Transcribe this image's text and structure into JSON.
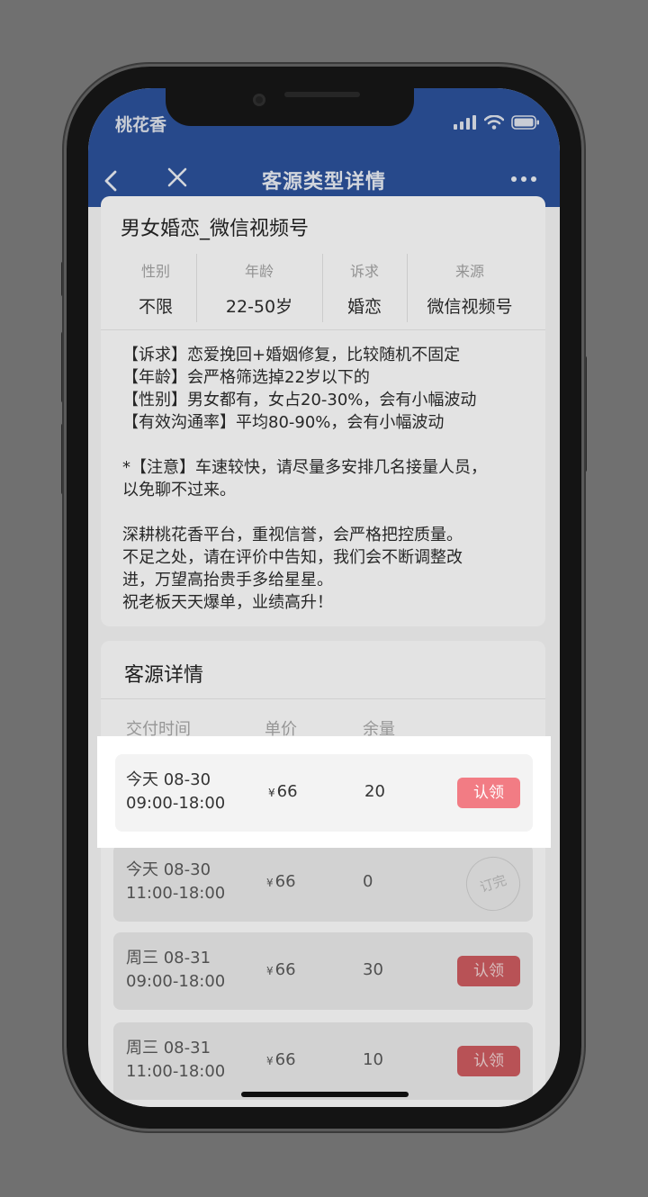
{
  "status_bar": {
    "carrier": "桃花香"
  },
  "nav": {
    "title": "客源类型详情"
  },
  "summary": {
    "title": "男女婚恋_微信视频号",
    "attributes": [
      {
        "label": "性别",
        "value": "不限"
      },
      {
        "label": "年龄",
        "value": "22-50岁"
      },
      {
        "label": "诉求",
        "value": "婚恋"
      },
      {
        "label": "来源",
        "value": "微信视频号"
      }
    ],
    "description": [
      "【诉求】恋爱挽回+婚姻修复，比较随机不固定",
      "【年龄】会严格筛选掉22岁以下的",
      "【性别】男女都有，女占20-30%，会有小幅波动",
      "【有效沟通率】平均80-90%，会有小幅波动",
      "",
      "*【注意】车速较快，请尽量多安排几名接量人员，",
      "以免聊不过来。",
      "",
      "深耕桃花香平台，重视信誉，会严格把控质量。",
      "不足之处，请在评价中告知，我们会不断调整改",
      "进，万望高抬贵手多给星星。",
      "祝老板天天爆单，业绩高升！"
    ]
  },
  "details": {
    "title": "客源详情",
    "columns": [
      "交付时间",
      "单价",
      "余量"
    ],
    "currency": "¥",
    "claim_label": "认领",
    "soldout_label": "订完",
    "rows": [
      {
        "day": "今天 08-30",
        "time": "09:00-18:00",
        "price": "66",
        "stock": "20",
        "status": "claim"
      },
      {
        "day": "今天 08-30",
        "time": "11:00-18:00",
        "price": "66",
        "stock": "0",
        "status": "soldout"
      },
      {
        "day": "周三 08-31",
        "time": "09:00-18:00",
        "price": "66",
        "stock": "30",
        "status": "claim"
      },
      {
        "day": "周三 08-31",
        "time": "11:00-18:00",
        "price": "66",
        "stock": "10",
        "status": "claim"
      }
    ]
  }
}
